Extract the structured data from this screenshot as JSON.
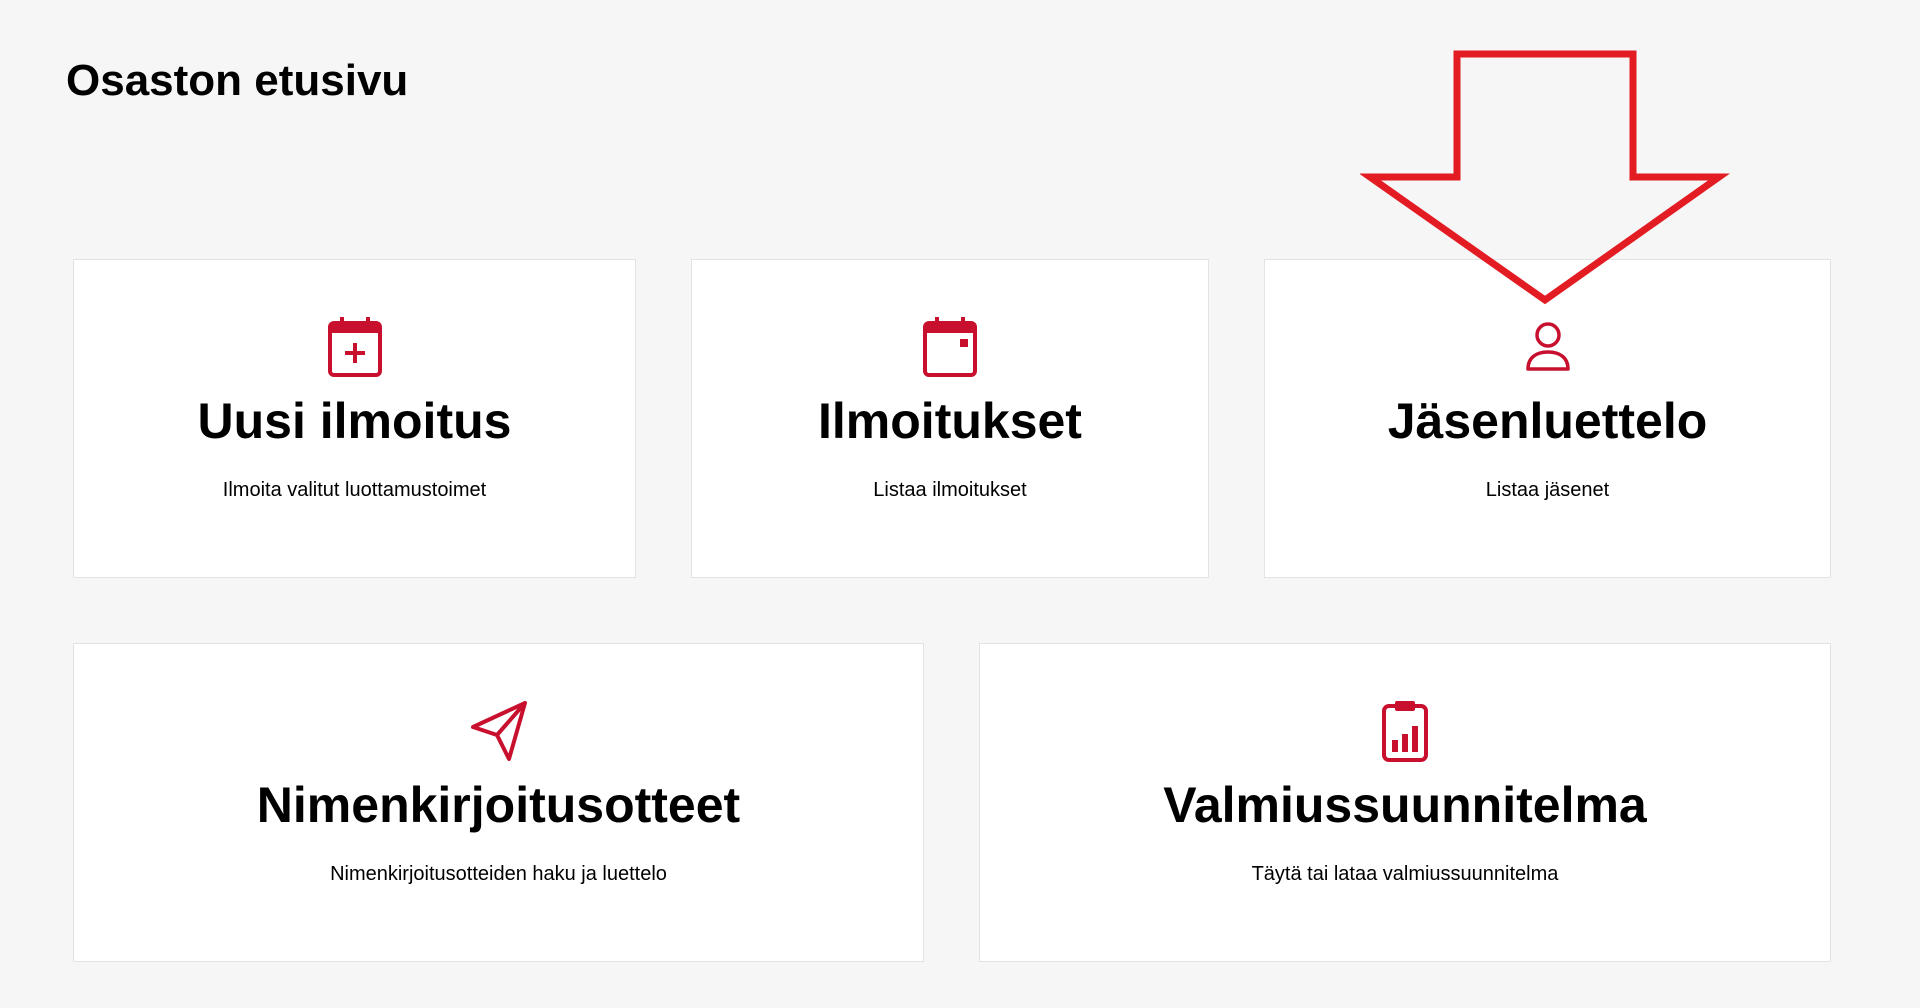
{
  "page": {
    "title": "Osaston etusivu"
  },
  "colors": {
    "accent": "#c8102e",
    "annotation": "#e31b23",
    "background": "#f6f6f6",
    "card_background": "#ffffff"
  },
  "cards": [
    {
      "icon": "calendar-plus-icon",
      "title": "Uusi ilmoitus",
      "description": "Ilmoita valitut luottamustoimet"
    },
    {
      "icon": "calendar-icon",
      "title": "Ilmoitukset",
      "description": "Listaa ilmoitukset"
    },
    {
      "icon": "person-icon",
      "title": "Jäsenluettelo",
      "description": "Listaa jäsenet"
    },
    {
      "icon": "paper-plane-icon",
      "title": "Nimenkirjoitusotteet",
      "description": "Nimenkirjoitusotteiden haku ja luettelo"
    },
    {
      "icon": "clipboard-chart-icon",
      "title": "Valmiussuunnitelma",
      "description": "Täytä tai lataa valmiussuunnitelma"
    }
  ],
  "annotation": {
    "icon": "down-arrow-outline-icon"
  }
}
